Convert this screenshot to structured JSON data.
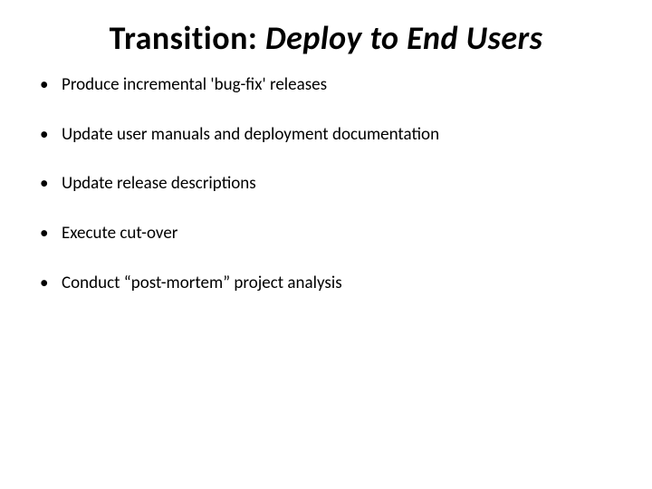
{
  "slide": {
    "title": {
      "prefix": "Transition: ",
      "suffix": "Deploy to End Users"
    },
    "bullets": [
      "Produce  incremental 'bug-fix' releases",
      "Update user manuals and deployment documentation",
      "Update release descriptions",
      "Execute cut-over",
      "Conduct “post-mortem” project analysis"
    ]
  }
}
